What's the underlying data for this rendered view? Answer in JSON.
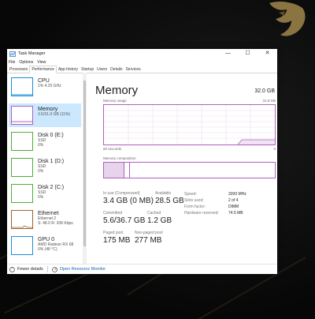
{
  "window": {
    "title": "Task Manager",
    "controls": [
      "—",
      "☐",
      "✕"
    ]
  },
  "menu": [
    "File",
    "Options",
    "View"
  ],
  "tabs": [
    "Processes",
    "Performance",
    "App history",
    "Startup",
    "Users",
    "Details",
    "Services"
  ],
  "active_tab": "Performance",
  "sidebar": [
    {
      "name": "CPU",
      "line1": "1% 4.25 GHz",
      "line2": "",
      "color": "#1a8fd8",
      "selected": false
    },
    {
      "name": "Memory",
      "line1": "3.5/31.9 GB (11%)",
      "line2": "",
      "color": "#b05fbf",
      "selected": true
    },
    {
      "name": "Disk 0 (E:)",
      "line1": "SSD",
      "line2": "0%",
      "color": "#4caf35",
      "selected": false
    },
    {
      "name": "Disk 1 (D:)",
      "line1": "SSD",
      "line2": "0%",
      "color": "#4caf35",
      "selected": false
    },
    {
      "name": "Disk 2 (C:)",
      "line1": "SSD",
      "line2": "0%",
      "color": "#4caf35",
      "selected": false
    },
    {
      "name": "Ethernet",
      "line1": "Ethernet 2",
      "line2": "S: 48.0  R: 208 Kbps",
      "color": "#a0632a",
      "selected": false
    },
    {
      "name": "GPU 0",
      "line1": "AMD Radeon RX 68",
      "line2": "0% (48 °C)",
      "color": "#1a8fd8",
      "selected": false
    }
  ],
  "memory": {
    "title": "Memory",
    "total": "32.0 GB",
    "usage_label": "Memory usage",
    "usage_max": "31.9 GB",
    "time_label": "60 seconds",
    "time_end": "0",
    "composition_label": "Memory composition",
    "stats": {
      "in_use_label": "In use (Compressed)",
      "in_use": "3.4 GB (0 MB)",
      "available_label": "Available",
      "available": "28.5 GB",
      "committed_label": "Committed",
      "committed": "5.6/36.7 GB",
      "cached_label": "Cached",
      "cached": "1.2 GB",
      "paged_label": "Paged pool",
      "paged": "175 MB",
      "nonpaged_label": "Non-paged pool",
      "nonpaged": "277 MB"
    },
    "specs": [
      {
        "k": "Speed:",
        "v": "3200 MHz"
      },
      {
        "k": "Slots used:",
        "v": "2 of 4"
      },
      {
        "k": "Form factor:",
        "v": "DIMM"
      },
      {
        "k": "Hardware reserved:",
        "v": "74.5 MB"
      }
    ]
  },
  "footer": {
    "fewer": "Fewer details",
    "open_rm": "Open Resource Monitor"
  },
  "colors": {
    "memory": "#b05fbf",
    "selected_bg": "#cce8ff"
  }
}
